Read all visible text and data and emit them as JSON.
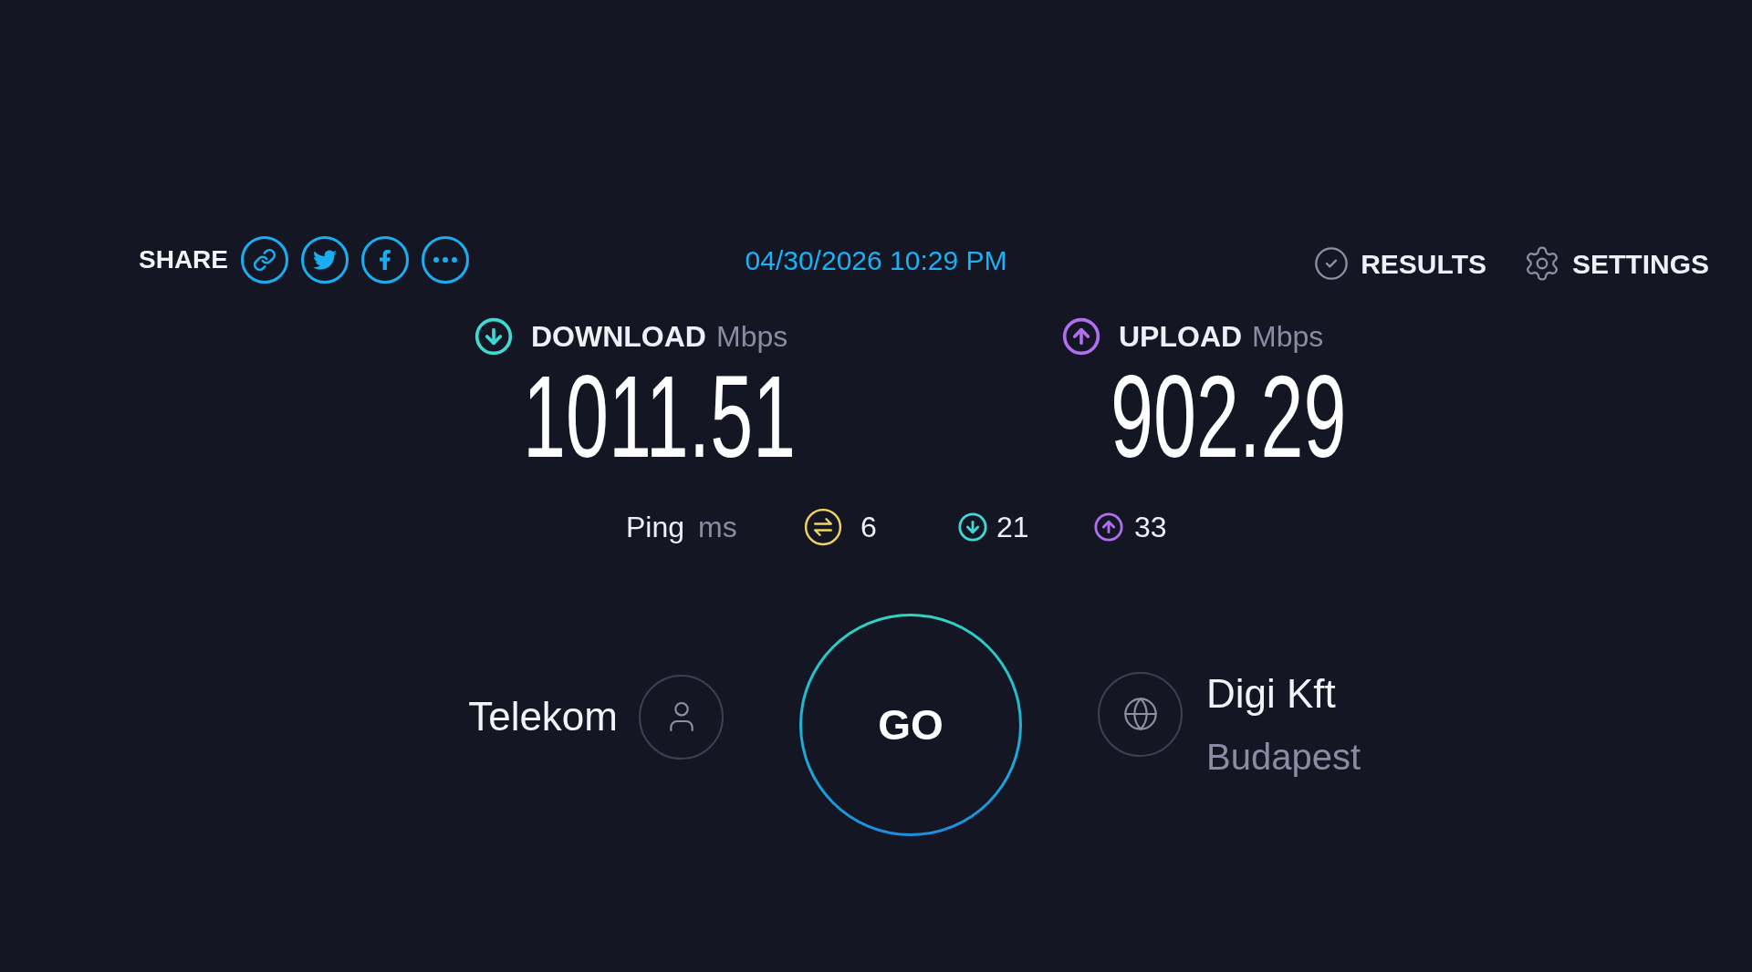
{
  "share": {
    "label": "SHARE"
  },
  "timestamp": "04/30/2026 10:29 PM",
  "results_button": {
    "label": "RESULTS"
  },
  "settings_button": {
    "label": "SETTINGS"
  },
  "download": {
    "label": "DOWNLOAD",
    "unit": "Mbps",
    "value": "1011.51"
  },
  "upload": {
    "label": "UPLOAD",
    "unit": "Mbps",
    "value": "902.29"
  },
  "ping": {
    "label": "Ping",
    "unit": "ms",
    "idle": "6",
    "download": "21",
    "upload": "33"
  },
  "isp": {
    "name": "Telekom"
  },
  "go_button": {
    "label": "GO"
  },
  "server": {
    "name": "Digi Kft",
    "location": "Budapest"
  }
}
